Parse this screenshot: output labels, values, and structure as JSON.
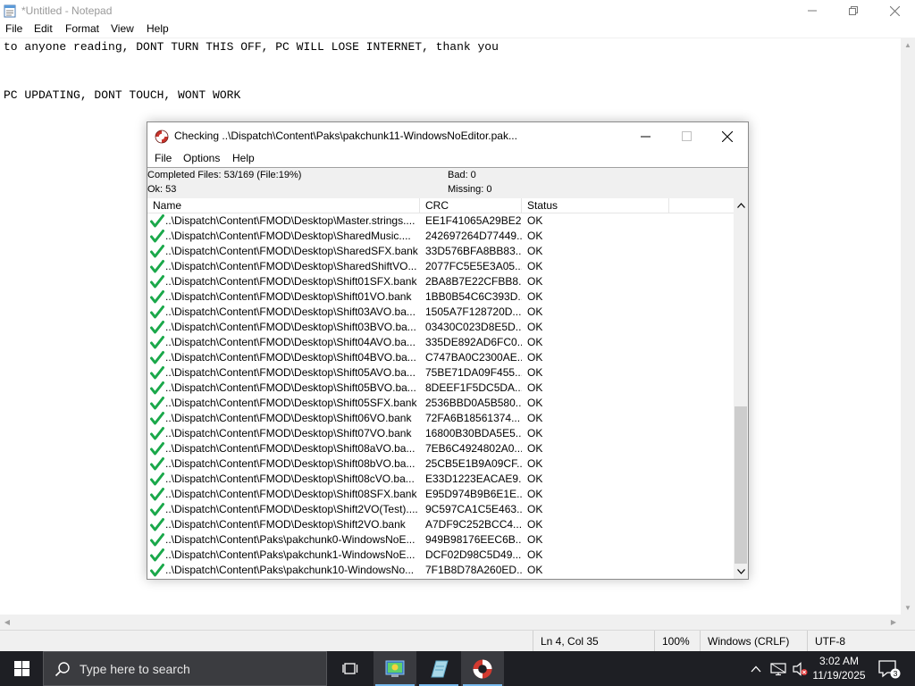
{
  "notepad": {
    "title": "*Untitled - Notepad",
    "menu": [
      "File",
      "Edit",
      "Format",
      "View",
      "Help"
    ],
    "lines": [
      "to anyone reading, DONT TURN THIS OFF, PC WILL LOSE INTERNET, thank you",
      "",
      "",
      "PC UPDATING, DONT TOUCH, WONT WORK"
    ],
    "status": {
      "position": "Ln 4, Col 35",
      "zoom": "100%",
      "line_ending": "Windows (CRLF)",
      "encoding": "UTF-8"
    }
  },
  "checker": {
    "title": "Checking ..\\Dispatch\\Content\\Paks\\pakchunk11-WindowsNoEditor.pak...",
    "menu": [
      "File",
      "Options",
      "Help"
    ],
    "stats": {
      "completed": "Completed Files: 53/169 (File:19%)",
      "bad": "Bad: 0",
      "ok": "Ok: 53",
      "missing": "Missing: 0"
    },
    "columns": [
      "Name",
      "CRC",
      "Status"
    ],
    "rows": [
      {
        "name": "..\\Dispatch\\Content\\FMOD\\Desktop\\Master.strings....",
        "crc": "EE1F41065A29BE2...",
        "status": "OK"
      },
      {
        "name": "..\\Dispatch\\Content\\FMOD\\Desktop\\SharedMusic....",
        "crc": "242697264D77449...",
        "status": "OK"
      },
      {
        "name": "..\\Dispatch\\Content\\FMOD\\Desktop\\SharedSFX.bank",
        "crc": "33D576BFA8BB83...",
        "status": "OK"
      },
      {
        "name": "..\\Dispatch\\Content\\FMOD\\Desktop\\SharedShiftVO...",
        "crc": "2077FC5E5E3A05...",
        "status": "OK"
      },
      {
        "name": "..\\Dispatch\\Content\\FMOD\\Desktop\\Shift01SFX.bank",
        "crc": "2BA8B7E22CFBB8...",
        "status": "OK"
      },
      {
        "name": "..\\Dispatch\\Content\\FMOD\\Desktop\\Shift01VO.bank",
        "crc": "1BB0B54C6C393D...",
        "status": "OK"
      },
      {
        "name": "..\\Dispatch\\Content\\FMOD\\Desktop\\Shift03AVO.ba...",
        "crc": "1505A7F128720D...",
        "status": "OK"
      },
      {
        "name": "..\\Dispatch\\Content\\FMOD\\Desktop\\Shift03BVO.ba...",
        "crc": "03430C023D8E5D...",
        "status": "OK"
      },
      {
        "name": "..\\Dispatch\\Content\\FMOD\\Desktop\\Shift04AVO.ba...",
        "crc": "335DE892AD6FC0...",
        "status": "OK"
      },
      {
        "name": "..\\Dispatch\\Content\\FMOD\\Desktop\\Shift04BVO.ba...",
        "crc": "C747BA0C2300AE...",
        "status": "OK"
      },
      {
        "name": "..\\Dispatch\\Content\\FMOD\\Desktop\\Shift05AVO.ba...",
        "crc": "75BE71DA09F455...",
        "status": "OK"
      },
      {
        "name": "..\\Dispatch\\Content\\FMOD\\Desktop\\Shift05BVO.ba...",
        "crc": "8DEEF1F5DC5DA...",
        "status": "OK"
      },
      {
        "name": "..\\Dispatch\\Content\\FMOD\\Desktop\\Shift05SFX.bank",
        "crc": "2536BBD0A5B580...",
        "status": "OK"
      },
      {
        "name": "..\\Dispatch\\Content\\FMOD\\Desktop\\Shift06VO.bank",
        "crc": "72FA6B18561374...",
        "status": "OK"
      },
      {
        "name": "..\\Dispatch\\Content\\FMOD\\Desktop\\Shift07VO.bank",
        "crc": "16800B30BDA5E5...",
        "status": "OK"
      },
      {
        "name": "..\\Dispatch\\Content\\FMOD\\Desktop\\Shift08aVO.ba...",
        "crc": "7EB6C4924802A0...",
        "status": "OK"
      },
      {
        "name": "..\\Dispatch\\Content\\FMOD\\Desktop\\Shift08bVO.ba...",
        "crc": "25CB5E1B9A09CF...",
        "status": "OK"
      },
      {
        "name": "..\\Dispatch\\Content\\FMOD\\Desktop\\Shift08cVO.ba...",
        "crc": "E33D1223EACAE9...",
        "status": "OK"
      },
      {
        "name": "..\\Dispatch\\Content\\FMOD\\Desktop\\Shift08SFX.bank",
        "crc": "E95D974B9B6E1E...",
        "status": "OK"
      },
      {
        "name": "..\\Dispatch\\Content\\FMOD\\Desktop\\Shift2VO(Test)....",
        "crc": "9C597CA1C5E463...",
        "status": "OK"
      },
      {
        "name": "..\\Dispatch\\Content\\FMOD\\Desktop\\Shift2VO.bank",
        "crc": "A7DF9C252BCC4...",
        "status": "OK"
      },
      {
        "name": "..\\Dispatch\\Content\\Paks\\pakchunk0-WindowsNoE...",
        "crc": "949B98176EEC6B...",
        "status": "OK"
      },
      {
        "name": "..\\Dispatch\\Content\\Paks\\pakchunk1-WindowsNoE...",
        "crc": "DCF02D98C5D49...",
        "status": "OK"
      },
      {
        "name": "..\\Dispatch\\Content\\Paks\\pakchunk10-WindowsNo...",
        "crc": "7F1B8D78A260ED...",
        "status": "OK"
      }
    ]
  },
  "taskbar": {
    "search_placeholder": "Type here to search",
    "time": "3:02 AM",
    "date": "11/19/2025",
    "notification_count": "3"
  },
  "colors": {
    "check_green": "#1aa84a",
    "taskbar_bg": "#1e1f24",
    "accent_underline": "#76b9ed"
  }
}
